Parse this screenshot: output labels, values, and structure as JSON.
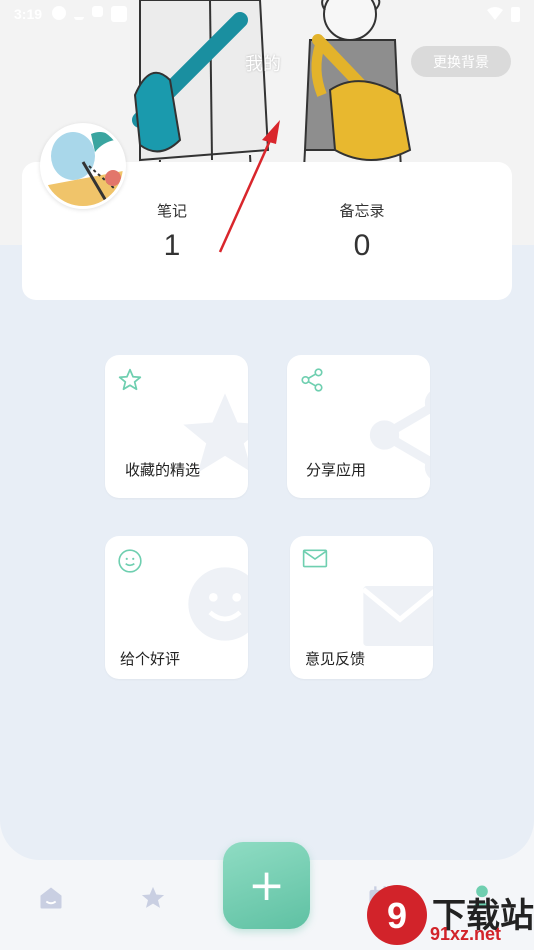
{
  "status_bar": {
    "time": "3:19"
  },
  "header": {
    "title": "我的",
    "change_background": "更换背景"
  },
  "stats": [
    {
      "label": "笔记",
      "value": "1"
    },
    {
      "label": "备忘录",
      "value": "0"
    }
  ],
  "features": [
    {
      "label": "收藏的精选",
      "icon": "star-icon"
    },
    {
      "label": "分享应用",
      "icon": "share-icon"
    },
    {
      "label": "给个好评",
      "icon": "smile-icon"
    },
    {
      "label": "意见反馈",
      "icon": "mail-icon"
    }
  ],
  "bottom_nav": {
    "items": [
      "home-icon",
      "star-icon",
      "add-icon",
      "calendar-icon",
      "profile-icon"
    ],
    "fab_label": "+"
  },
  "watermark": {
    "title": "下载站",
    "url": "91xz.net"
  },
  "colors": {
    "accent": "#6fcfb0",
    "panel": "#e8eef6",
    "arrow": "#d9262c"
  }
}
